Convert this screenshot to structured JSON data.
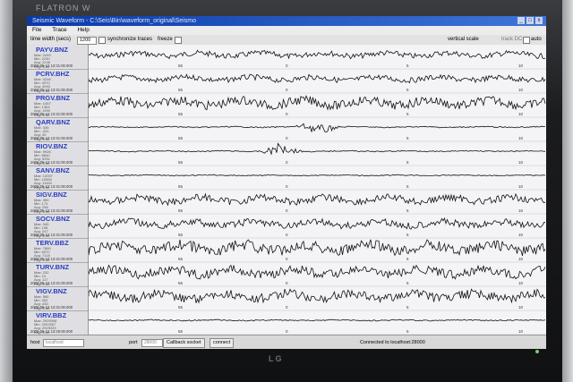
{
  "monitor": {
    "brand_top": "FLATRON W",
    "brand_bottom": "LG"
  },
  "window": {
    "title": "Seismic Waveform - C:\\Seis\\Bin\\waveform_original\\Seismo",
    "buttons": [
      "_",
      "□",
      "x"
    ]
  },
  "menu": [
    "File",
    "Trace",
    "Help"
  ],
  "toolbar": {
    "time_width_label": "time width (secs)",
    "time_width_value": "1200",
    "sync_label": "synchronize traces",
    "freeze_label": "freeze",
    "vertical_scale_label": "vertical scale",
    "track_dc_label": "track DC",
    "auto_label": "auto"
  },
  "traces": [
    {
      "name": "PAYV.BNZ",
      "meta": "Max: 2449\nMin: 2230\nAvg: 2246\nRng: 5.00",
      "time": "2009-05-12 13:31:00.000"
    },
    {
      "name": "PCRV.BHZ",
      "meta": "Max: 4246\nMin: 4070\nAvg: 4093\nRng: 5.00",
      "time": "2009-05-12 13:31:00.000"
    },
    {
      "name": "PRGV.BNZ",
      "meta": "Max: 1457\nMin: 1364\nAvg: 1390\nRng: 5.00",
      "time": "2009-05-12 13:31:00.000"
    },
    {
      "name": "QARV.BNZ",
      "meta": "Max: 345\nMin: -251\nAvg: 49\nRng: 5.00",
      "time": "2009-05-12 13:31:00.000"
    },
    {
      "name": "RIOV.BNZ",
      "meta": "Max: 9926\nMin: 8840\nAvg: 9251\nRng: 5.00",
      "time": "2009-05-12 13:31:00.000"
    },
    {
      "name": "SANV.BNZ",
      "meta": "Max: 12007\nMin: 10550\nAvg: 11000\nRng: 5.00",
      "time": "2009-05-12 13:31:00.000"
    },
    {
      "name": "SIGV.BNZ",
      "meta": "Max: 350\nMin: 174\nAvg: 256\nRng: 5.00",
      "time": "2009-05-12 13:31:00.000"
    },
    {
      "name": "SOCV.BNZ",
      "meta": "Max: 345\nMin: 198\nAvg: 247\nRng: 5.00",
      "time": "2009-05-12 13:31:00.000"
    },
    {
      "name": "TERV.BBZ",
      "meta": "Max: 7860\nMin: 6570\nAvg: 7100\nRng: 5.00",
      "time": "2009-05-12 13:31:00.000"
    },
    {
      "name": "TURV.BNZ",
      "meta": "Max: 232\nMin: 10\nAvg: 117\nRng: 5.00",
      "time": "2009-05-12 13:31:00.000"
    },
    {
      "name": "VIGV.BNZ",
      "meta": "Max: 566\nMin: 302\nAvg: 430\nRng: 5.00",
      "time": "2009-05-12 13:31:00.000"
    },
    {
      "name": "VIRV.BBZ",
      "meta": "Max: 2929398\nMin: 2929267\nAvg: 2929333\nRng: 5.00",
      "time": "2009-05-12 13:25:00.000"
    }
  ],
  "tick_labels": [
    "55",
    "0",
    "5",
    "10"
  ],
  "status": {
    "host_label": "host",
    "host_value": "localhost",
    "port_label": "port",
    "port_value": "28000",
    "callback_label": "Callback socket",
    "connect_label": "connect",
    "connected_text": "Connected to localhost:28000"
  },
  "colors": {
    "title_bar": "#0a3aa8",
    "trace_name": "#2a3dc0",
    "trace_line": "#111111"
  }
}
